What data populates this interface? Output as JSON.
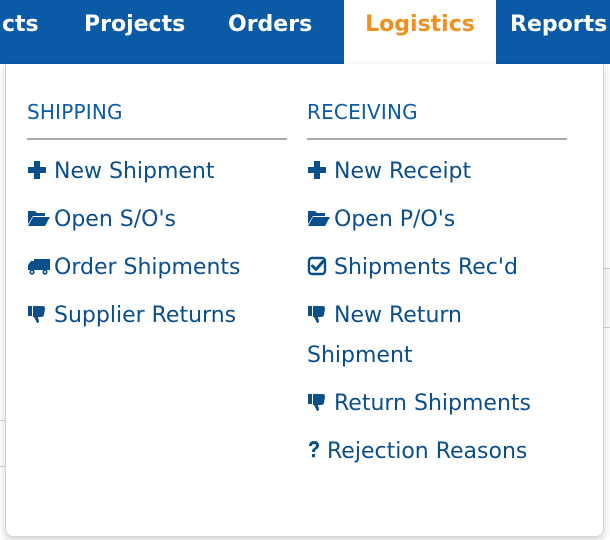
{
  "topnav": {
    "items": [
      {
        "label": "cts",
        "active": false
      },
      {
        "label": "Projects",
        "active": false
      },
      {
        "label": "Orders",
        "active": false
      },
      {
        "label": "Logistics",
        "active": true
      },
      {
        "label": "Reports",
        "active": false
      }
    ]
  },
  "colors": {
    "nav_bg": "#0b5aa6",
    "nav_active_text": "#f0901e",
    "link_text": "#0b4f8a"
  },
  "dropdown": {
    "shipping": {
      "heading": "SHIPPING",
      "items": [
        {
          "icon": "plus-icon",
          "label": "New Shipment"
        },
        {
          "icon": "folder-open-icon",
          "label": "Open S/O's"
        },
        {
          "icon": "truck-icon",
          "label": "Order Shipments"
        },
        {
          "icon": "thumbs-down-icon",
          "label": "Supplier Returns"
        }
      ]
    },
    "receiving": {
      "heading": "RECEIVING",
      "items": [
        {
          "icon": "plus-icon",
          "label": "New Receipt"
        },
        {
          "icon": "folder-open-icon",
          "label": "Open P/O's"
        },
        {
          "icon": "check-square-icon",
          "label": "Shipments Rec'd"
        },
        {
          "icon": "thumbs-down-icon",
          "label": "New Return Shipment"
        },
        {
          "icon": "thumbs-down-icon",
          "label": "Return Shipments"
        },
        {
          "icon": "question-icon",
          "label": "Rejection Reasons"
        }
      ]
    }
  }
}
